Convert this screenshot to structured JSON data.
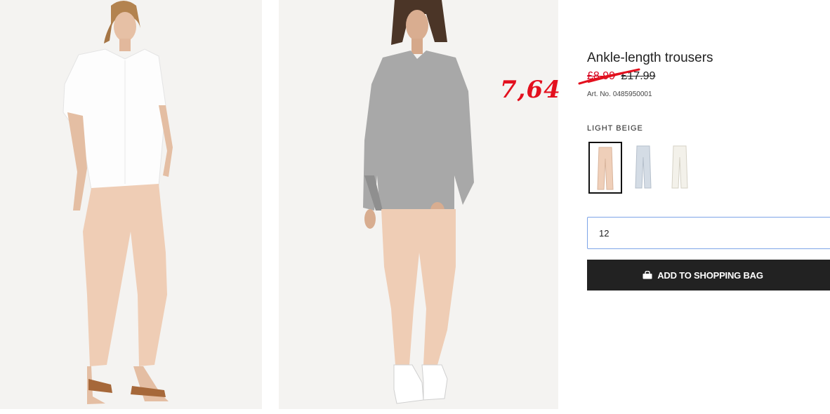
{
  "product": {
    "title": "Ankle-length trousers",
    "sale_price": "£8.99",
    "original_price": "£17.99",
    "handwritten_price": "7,64",
    "art_no_label": "Art. No.",
    "art_no": "0485950001"
  },
  "colors": {
    "selected_label": "LIGHT BEIGE",
    "swatches": [
      {
        "icon": "beige-trousers-icon",
        "color": "#efcfb9",
        "selected": true
      },
      {
        "icon": "light-blue-trousers-icon",
        "color": "#d4dce5",
        "selected": false
      },
      {
        "icon": "white-trousers-icon",
        "color": "#f3f1ea",
        "selected": false
      }
    ]
  },
  "size_input": {
    "value": "12"
  },
  "add_button": {
    "label": "ADD TO SHOPPING BAG",
    "icon": "shopping-bag-icon"
  },
  "theme": {
    "accent_red": "#e3101e",
    "button_bg": "#222222",
    "input_border": "#7da4e8"
  }
}
